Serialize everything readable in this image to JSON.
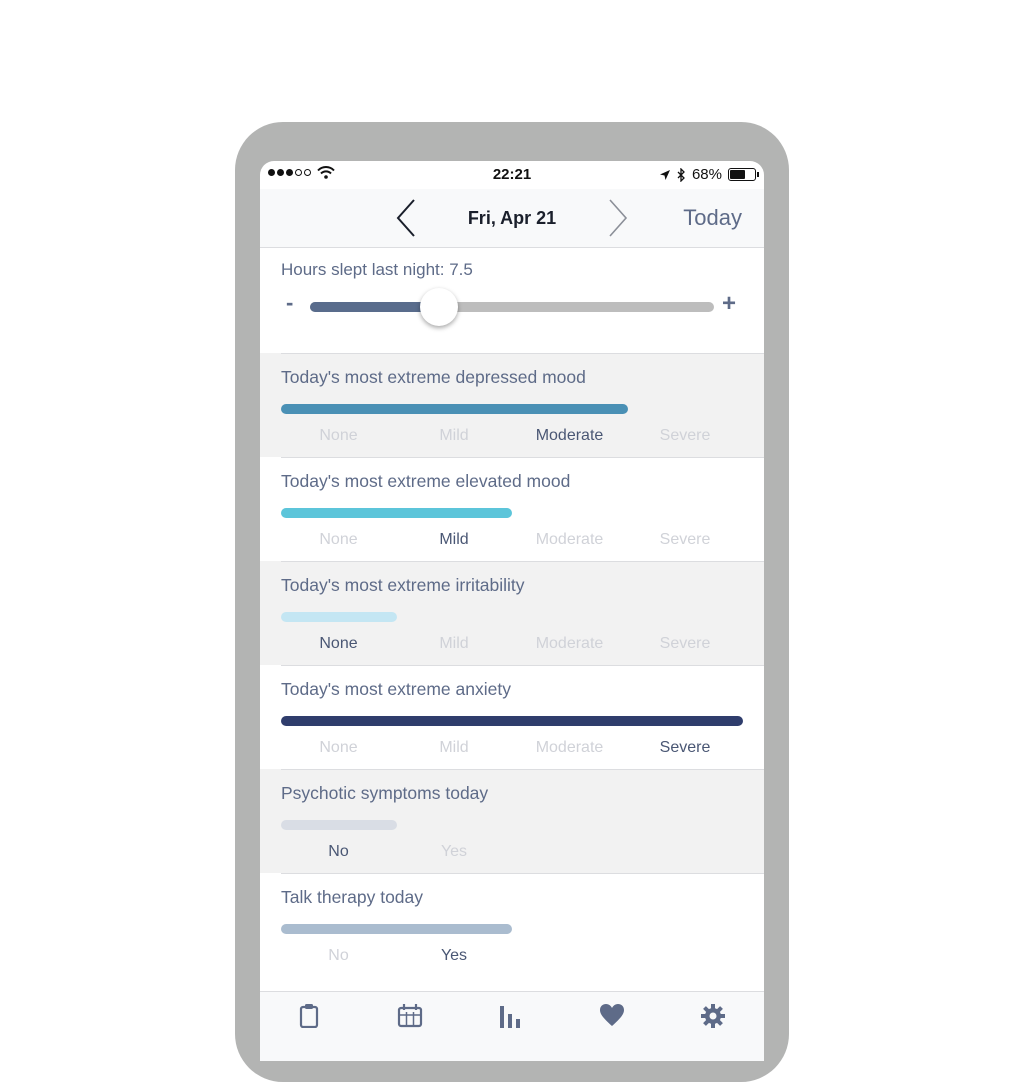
{
  "status_bar": {
    "time": "22:21",
    "battery_text": "68%",
    "battery_level": 0.68,
    "signal_bars": 3,
    "signal_total": 5
  },
  "nav": {
    "date": "Fri, Apr 21",
    "today_label": "Today",
    "prev_icon": "chevron-left-icon",
    "next_icon": "chevron-right-icon"
  },
  "sleep": {
    "label": "Hours slept last night: 7.5",
    "minus": "-",
    "plus": "+",
    "value": 7.5,
    "fraction": 0.32
  },
  "sections": [
    {
      "title": "Today's most extreme depressed mood",
      "options": [
        "None",
        "Mild",
        "Moderate",
        "Severe"
      ],
      "selected": 2,
      "color": "#4a90b5",
      "background": "gray"
    },
    {
      "title": "Today's most extreme elevated mood",
      "options": [
        "None",
        "Mild",
        "Moderate",
        "Severe"
      ],
      "selected": 1,
      "color": "#5cc5da",
      "background": "white"
    },
    {
      "title": "Today's most extreme irritability",
      "options": [
        "None",
        "Mild",
        "Moderate",
        "Severe"
      ],
      "selected": 0,
      "color": "#c4e6f3",
      "background": "gray"
    },
    {
      "title": "Today's most extreme anxiety",
      "options": [
        "None",
        "Mild",
        "Moderate",
        "Severe"
      ],
      "selected": 3,
      "color": "#2f3d6c",
      "background": "white"
    },
    {
      "title": "Psychotic symptoms today",
      "options": [
        "No",
        "Yes"
      ],
      "selected": 0,
      "color": "#d9dde5",
      "background": "gray"
    },
    {
      "title": "Talk therapy today",
      "options": [
        "No",
        "Yes"
      ],
      "selected": 1,
      "color": "#aabccf",
      "background": "white"
    }
  ],
  "tabs": [
    "clipboard-icon",
    "calendar-icon",
    "chart-icon",
    "heart-icon",
    "gear-icon"
  ],
  "colors": {
    "accent_text": "#5e6b88",
    "slider_fill": "#596c8c",
    "unselected_option": "#d0d2d8",
    "selected_option": "#4a5774"
  }
}
